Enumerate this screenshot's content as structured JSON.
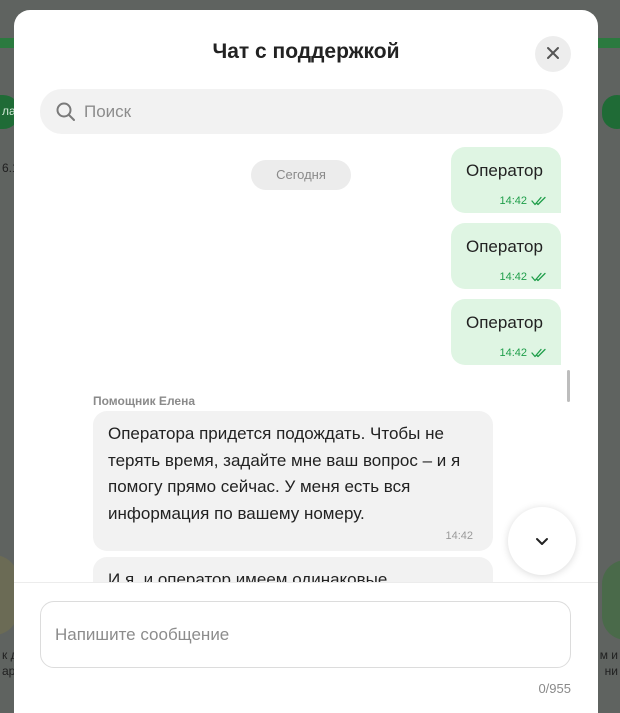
{
  "header": {
    "title": "Чат с поддержкой",
    "close_icon": "close-icon"
  },
  "search": {
    "placeholder": "Поиск",
    "icon": "search-icon"
  },
  "chat": {
    "date_separator": "Сегодня",
    "outgoing_messages": [
      {
        "text": "Оператор",
        "time": "14:42",
        "status_icon": "double-check-icon"
      },
      {
        "text": "Оператор",
        "time": "14:42",
        "status_icon": "double-check-icon"
      },
      {
        "text": "Оператор",
        "time": "14:42",
        "status_icon": "double-check-icon"
      }
    ],
    "sender_name": "Помощник Елена",
    "incoming_messages": [
      {
        "text": "Оператора придется подождать. Чтобы не терять время, задайте мне ваш вопрос – и я помогу прямо сейчас. У меня есть вся информация по вашему номеру.",
        "time": "14:42"
      },
      {
        "text": "И я, и оператор имеем одинаковые",
        "time": ""
      }
    ],
    "scroll_down_icon": "chevron-down-icon"
  },
  "composer": {
    "placeholder": "Напишите сообщение",
    "value": "",
    "counter": "0/955"
  },
  "background": {
    "left_labels": [
      "ла",
      "6.1",
      "к д",
      "ар"
    ],
    "right_labels": [
      "м и",
      "ни"
    ]
  },
  "colors": {
    "outgoing_bubble": "#dff5e3",
    "incoming_bubble": "#f2f2f2",
    "accent_green": "#1f9e4a"
  }
}
